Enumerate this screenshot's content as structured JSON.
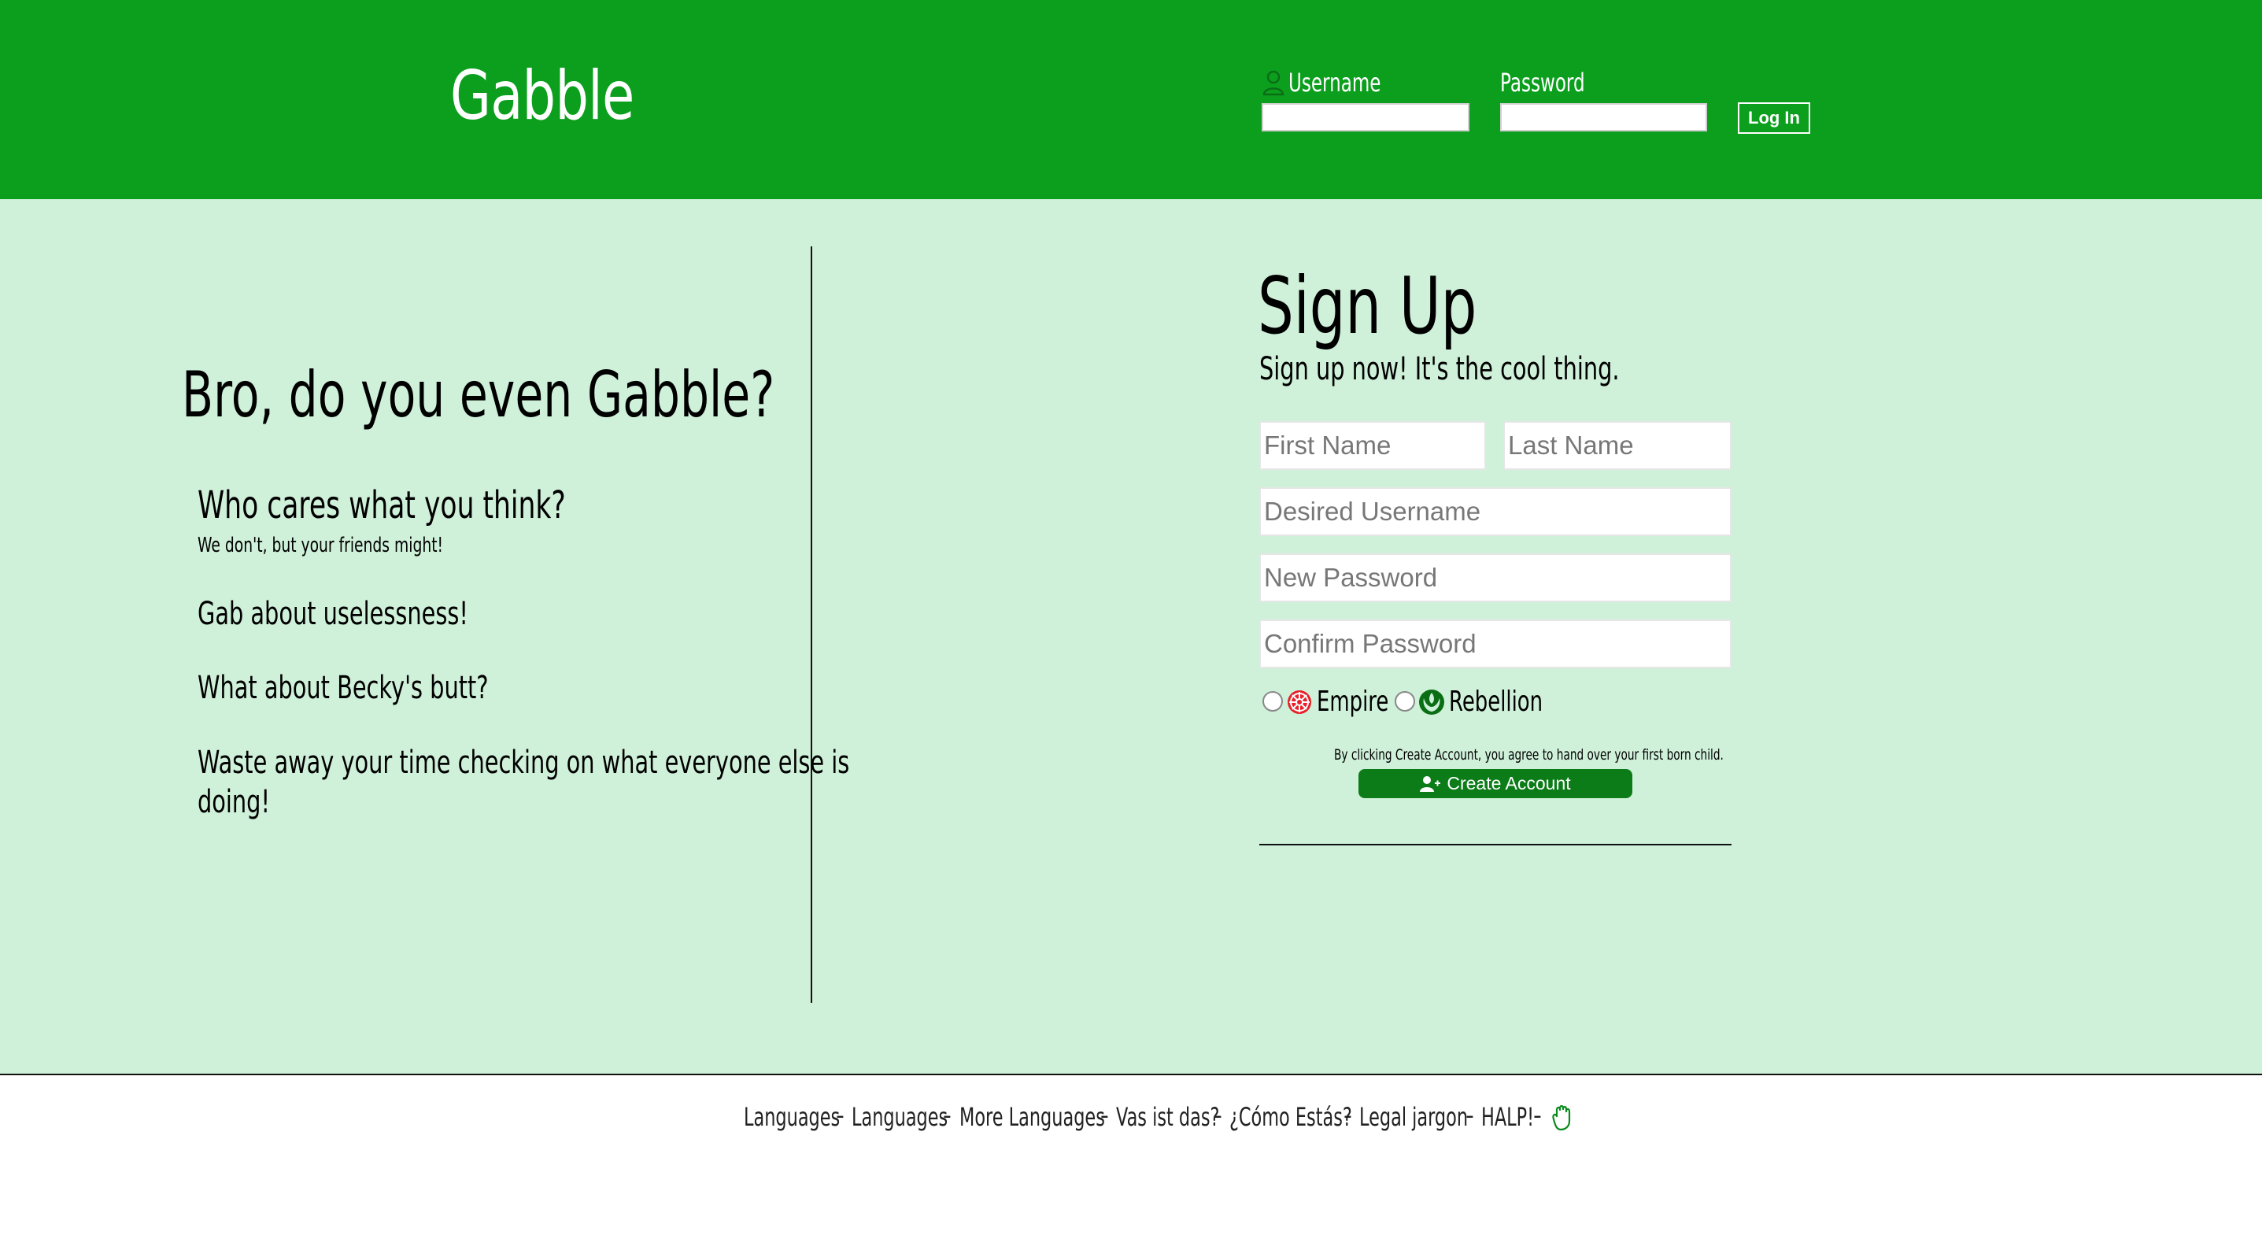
{
  "header": {
    "brand": "Gabble",
    "username_label": "Username",
    "password_label": "Password",
    "login_button": "Log In",
    "icons": {
      "user": "user-outline-icon"
    }
  },
  "hero": {
    "title": "Bro, do you even Gabble?",
    "features": [
      {
        "title": "Who cares what you think?",
        "subtitle": "We don't, but your friends might!"
      },
      {
        "title": "Gab about uselessness!"
      },
      {
        "title": "What about Becky's butt?"
      },
      {
        "title": "Waste away your time checking on what everyone else is",
        "title_line2": "doing!"
      }
    ]
  },
  "signup": {
    "title": "Sign Up",
    "subtitle": "Sign up now! It's the cool thing.",
    "placeholders": {
      "first_name": "First Name",
      "last_name": "Last Name",
      "username": "Desired Username",
      "new_password": "New Password",
      "confirm_password": "Confirm Password"
    },
    "factions": [
      {
        "label": "Empire",
        "icon": "empire-icon"
      },
      {
        "label": "Rebellion",
        "icon": "rebellion-icon"
      }
    ],
    "legal": "By clicking Create Account, you agree to hand over your first born child.",
    "create_button": "Create Account",
    "create_icon": "add-user-icon"
  },
  "footer": {
    "links": [
      "Languages",
      "Languages",
      "More Languages",
      "Vas ist das?",
      "¿Cómo Estás?",
      "Legal jargon",
      "HALP!"
    ],
    "separator": "-",
    "icon": "hand-icon"
  },
  "colors": {
    "header_bg": "#0c9f1e",
    "main_bg": "#cff0d9",
    "button_green": "#0b7c18"
  }
}
